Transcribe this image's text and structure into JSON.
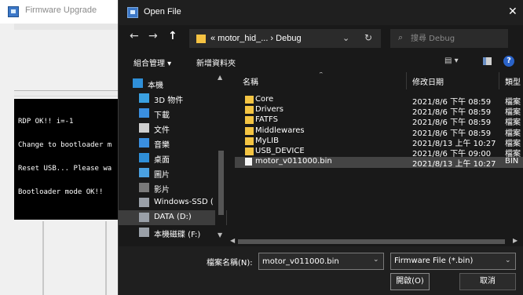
{
  "background_app": {
    "title": "Firmware Upgrade",
    "console_lines": [
      "RDP OK!! i=-1",
      "Change to bootloader m",
      "Reset USB... Please wa",
      "Bootloader mode OK!!"
    ]
  },
  "dialog": {
    "title": "Open File",
    "close_glyph": "✕",
    "nav": {
      "back_glyph": "←",
      "forward_glyph": "→",
      "up_glyph": "↑",
      "address_path": "« motor_hid_... › Debug",
      "address_drop_glyph": "⌄",
      "refresh_glyph": "↻",
      "search_placeholder": "搜尋 Debug",
      "search_icon_glyph": "⌕"
    },
    "toolbar": {
      "organize_label": "組合管理 ▾",
      "new_folder_label": "新增資料夾",
      "view_glyph": "▤ ▾",
      "help_glyph": "?"
    },
    "nav_pane": {
      "items": [
        {
          "label": "本機",
          "icon": "pc-icon",
          "color": "#2f8fd8"
        },
        {
          "label": "3D 物件",
          "icon": "cube-icon",
          "color": "#3aa0e0"
        },
        {
          "label": "下載",
          "icon": "download-icon",
          "color": "#3a8fe0"
        },
        {
          "label": "文件",
          "icon": "document-icon",
          "color": "#cfcfcf"
        },
        {
          "label": "音樂",
          "icon": "music-icon",
          "color": "#3a8fe0"
        },
        {
          "label": "桌面",
          "icon": "desktop-icon",
          "color": "#2f8fd8"
        },
        {
          "label": "圖片",
          "icon": "pictures-icon",
          "color": "#4aa0e0"
        },
        {
          "label": "影片",
          "icon": "video-icon",
          "color": "#7a7a7a"
        },
        {
          "label": "Windows-SSD (",
          "icon": "drive-icon",
          "color": "#9aa0a8"
        },
        {
          "label": "DATA (D:)",
          "icon": "drive-icon",
          "color": "#9aa0a8"
        },
        {
          "label": "本機磁碟 (F:)",
          "icon": "drive-icon",
          "color": "#9aa0a8"
        }
      ],
      "selected_index": 9
    },
    "file_list": {
      "columns": {
        "name": "名稱",
        "date": "修改日期",
        "type": "類型"
      },
      "rows": [
        {
          "name": "Core",
          "date": "2021/8/6 下午 08:59",
          "type": "檔案",
          "kind": "folder"
        },
        {
          "name": "Drivers",
          "date": "2021/8/6 下午 08:59",
          "type": "檔案",
          "kind": "folder"
        },
        {
          "name": "FATFS",
          "date": "2021/8/6 下午 08:59",
          "type": "檔案",
          "kind": "folder"
        },
        {
          "name": "Middlewares",
          "date": "2021/8/6 下午 08:59",
          "type": "檔案",
          "kind": "folder"
        },
        {
          "name": "MyLIB",
          "date": "2021/8/13 上午 10:27",
          "type": "檔案",
          "kind": "folder"
        },
        {
          "name": "USB_DEVICE",
          "date": "2021/8/6 下午 09:00",
          "type": "檔案",
          "kind": "folder"
        },
        {
          "name": "motor_v011000.bin",
          "date": "2021/8/13 上午 10:27",
          "type": "BIN",
          "kind": "file"
        }
      ],
      "selected_index": 6
    },
    "bottom": {
      "filename_label": "檔案名稱(N):",
      "filename_value": "motor_v011000.bin",
      "filter_value": "Firmware File (*.bin)",
      "open_label": "開啟(O)",
      "cancel_label": "取消"
    }
  },
  "colors": {
    "dialog_bg": "#191919",
    "folder": "#f3c443",
    "selection": "#444444",
    "accent": "#2a63c9"
  }
}
